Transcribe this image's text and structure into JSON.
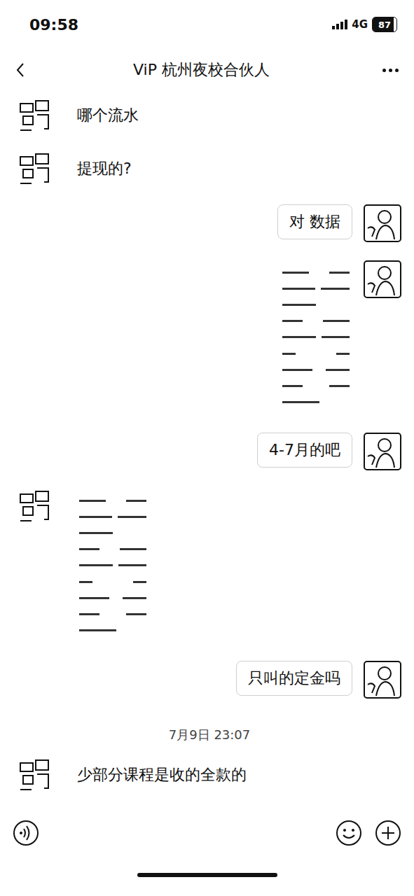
{
  "status_bar": {
    "time": "09:58",
    "network": "4G",
    "battery": "87",
    "battery_level": 0.87
  },
  "nav": {
    "title": "ViP 杭州夜校合伙人"
  },
  "messages": [
    {
      "kind": "text",
      "from_me": false,
      "text": "哪个流水"
    },
    {
      "kind": "text",
      "from_me": false,
      "text": "提现的?"
    },
    {
      "kind": "text",
      "from_me": true,
      "text": "对  数据"
    },
    {
      "kind": "image",
      "from_me": true
    },
    {
      "kind": "text",
      "from_me": true,
      "text": "4-7月的吧"
    },
    {
      "kind": "image",
      "from_me": false
    },
    {
      "kind": "text",
      "from_me": true,
      "text": "只叫的定金吗"
    },
    {
      "kind": "time",
      "text": "7月9日 23:07"
    },
    {
      "kind": "text",
      "from_me": false,
      "text": "少部分课程是收的全款的"
    }
  ]
}
